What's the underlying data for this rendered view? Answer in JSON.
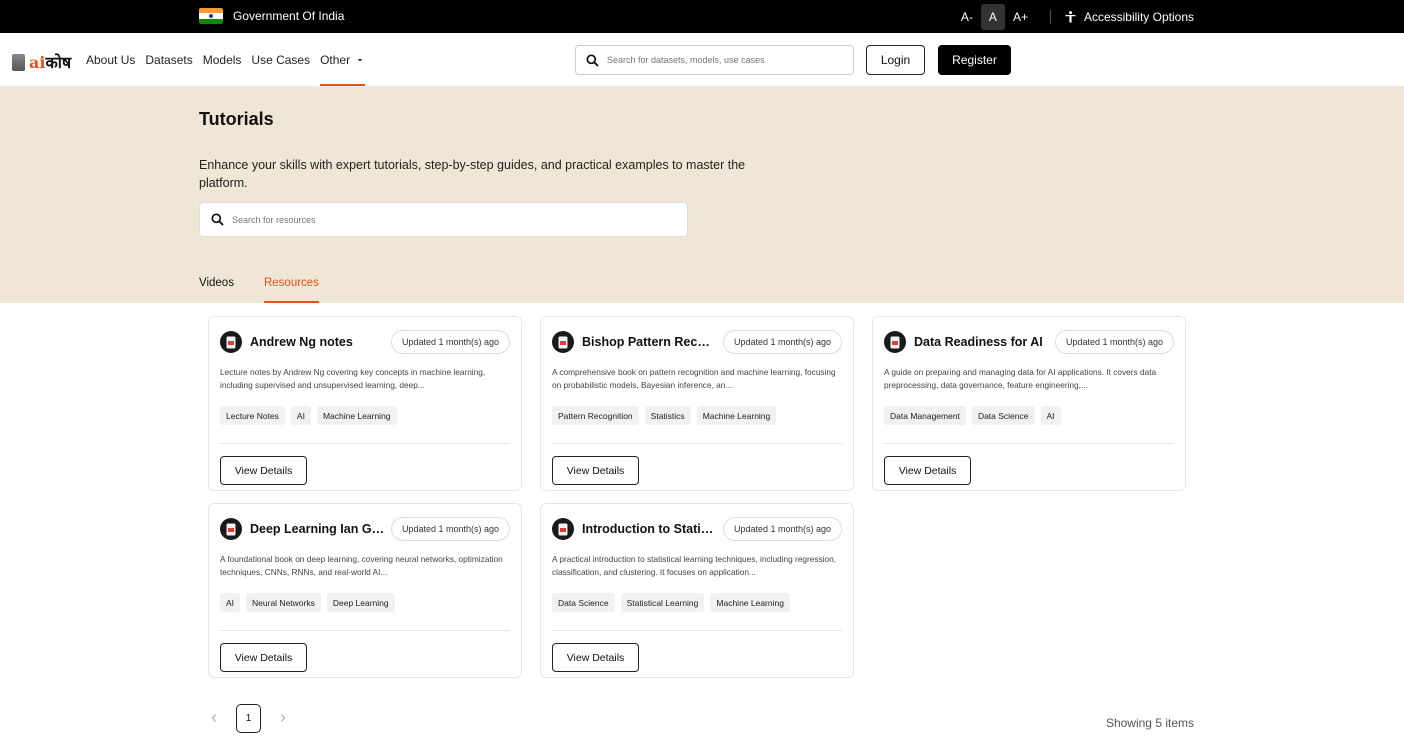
{
  "gov_bar": {
    "label": "Government Of India",
    "font_small": "A-",
    "font_normal": "A",
    "font_large": "A+",
    "accessibility": "Accessibility Options"
  },
  "nav": {
    "logo_ai": "ai",
    "logo_kosh": "कोष",
    "links": [
      "About Us",
      "Datasets",
      "Models",
      "Use Cases",
      "Other"
    ],
    "search_placeholder": "Search for datasets, models, use cases",
    "login": "Login",
    "register": "Register"
  },
  "hero": {
    "title": "Tutorials",
    "description": "Enhance your skills with expert tutorials, step-by-step guides, and practical examples to master the platform.",
    "search_placeholder": "Search for resources",
    "tabs": [
      "Videos",
      "Resources"
    ],
    "active_tab": "Resources"
  },
  "cards": [
    {
      "title": "Andrew Ng notes",
      "updated": "Updated 1 month(s) ago",
      "description": "Lecture notes by Andrew Ng covering key concepts in machine learning, including supervised and unsupervised learning, deep...",
      "tags": [
        "Lecture Notes",
        "AI",
        "Machine Learning"
      ],
      "button": "View Details"
    },
    {
      "title": "Bishop Pattern Recog...",
      "updated": "Updated 1 month(s) ago",
      "description": "A comprehensive book on pattern recognition and machine learning, focusing on probabilistic models, Bayesian inference, an...",
      "tags": [
        "Pattern Recognition",
        "Statistics",
        "Machine Learning"
      ],
      "button": "View Details"
    },
    {
      "title": "Data Readiness for AI",
      "updated": "Updated 1 month(s) ago",
      "description": "A guide on preparing and managing data for AI applications. It covers data preprocessing, data governance, feature engineering,...",
      "tags": [
        "Data Management",
        "Data Science",
        "AI"
      ],
      "button": "View Details"
    },
    {
      "title": "Deep Learning Ian Go...",
      "updated": "Updated 1 month(s) ago",
      "description": "A foundational book on deep learning, covering neural networks, optimization techniques, CNNs, RNNs, and real-world AI...",
      "tags": [
        "AI",
        "Neural Networks",
        "Deep Learning"
      ],
      "button": "View Details"
    },
    {
      "title": "Introduction to Statisti...",
      "updated": "Updated 1 month(s) ago",
      "description": "A practical introduction to statistical learning techniques, including regression, classification, and clustering. It focuses on application...",
      "tags": [
        "Data Science",
        "Statistical Learning",
        "Machine Learning"
      ],
      "button": "View Details"
    }
  ],
  "pagination": {
    "current_page": "1",
    "showing": "Showing 5 items"
  },
  "colors": {
    "accent": "#e4521b",
    "hero_bg": "#efe6d6",
    "topbar": "#000000"
  }
}
